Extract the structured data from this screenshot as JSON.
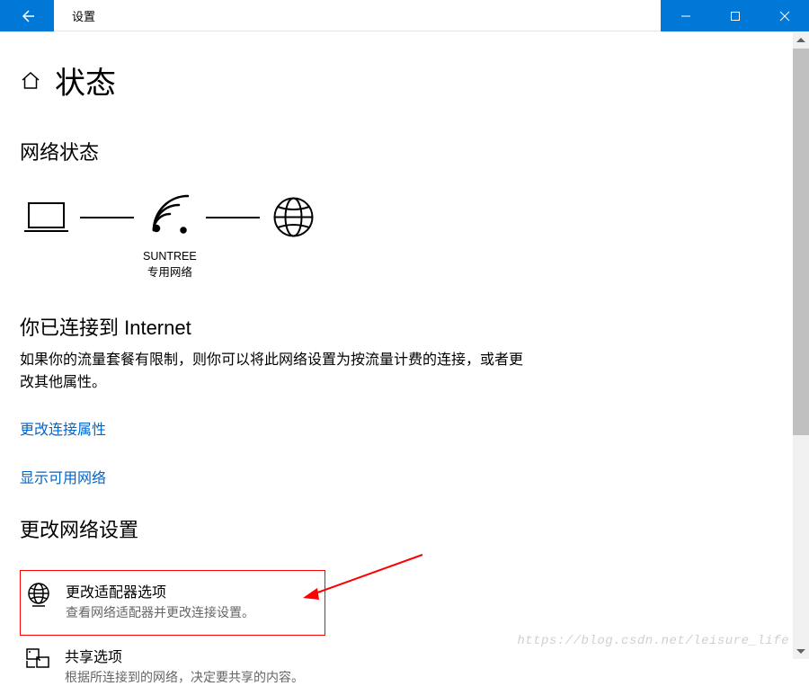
{
  "titlebar": {
    "title": "设置"
  },
  "page": {
    "title": "状态"
  },
  "network_status": {
    "section_title": "网络状态",
    "wifi_name": "SUNTREE",
    "wifi_type": "专用网络",
    "connected_title": "你已连接到 Internet",
    "connected_desc": "如果你的流量套餐有限制，则你可以将此网络设置为按流量计费的连接，或者更改其他属性。",
    "link_properties": "更改连接属性",
    "link_networks": "显示可用网络"
  },
  "change_settings": {
    "section_title": "更改网络设置",
    "items": [
      {
        "title": "更改适配器选项",
        "desc": "查看网络适配器并更改连接设置。"
      },
      {
        "title": "共享选项",
        "desc": "根据所连接到的网络，决定要共享的内容。"
      }
    ]
  },
  "watermark": "https://blog.csdn.net/leisure_life"
}
